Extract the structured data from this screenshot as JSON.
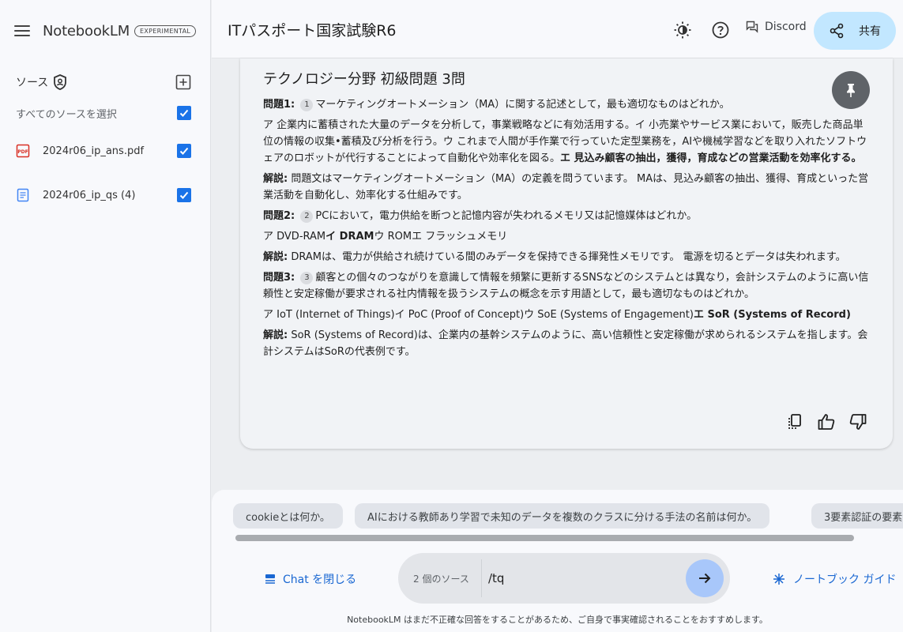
{
  "sidebar": {
    "brand_name": "NotebookLM",
    "brand_badge": "EXPERIMENTAL",
    "sources_title": "ソース",
    "select_all_label": "すべてのソースを選択",
    "sources": [
      {
        "name": "2024r06_ip_ans.pdf",
        "icon": "pdf-icon",
        "checked": true
      },
      {
        "name": "2024r06_ip_qs (4)",
        "icon": "document-icon",
        "checked": true
      }
    ]
  },
  "header": {
    "notebook_title": "ITパスポート国家試験R6",
    "discord_label": "Discord",
    "share_label": "共有"
  },
  "card": {
    "title": "テクノロジー分野 初級問題 3問",
    "q1": {
      "label": "問題1:",
      "ref": "1",
      "question": "マーケティングオートメーション（MA）に関する記述として，最も適切なものはどれか。",
      "options_text": "ア 企業内に蓄積された大量のデータを分析して，事業戦略などに有効活用する。イ 小売業やサービス業において，販売した商品単位の情報の収集•蓄積及び分析を行う。ウ これまで人間が手作業で行っていた定型業務を，AIや機械学習などを取り入れたソフトウェアのロボットが代行することによって自動化や効率化を図る。",
      "answer": "エ 見込み顧客の抽出，獲得，育成などの営業活動を効率化する。",
      "explain_label": "解説:",
      "explanation": "問題文はマーケティングオートメーション（MA）の定義を問うています。 MAは、見込み顧客の抽出、獲得、育成といった営業活動を自動化し、効率化する仕組みです。"
    },
    "q2": {
      "label": "問題2:",
      "ref": "2",
      "question": "PCにおいて，電力供給を断つと記憶内容が失われるメモリ又は記憶媒体はどれか。",
      "opt_a": "ア DVD-RAM",
      "answer": "イ DRAM",
      "opt_rest": "ウ ROMエ フラッシュメモリ",
      "explain_label": "解説:",
      "explanation": "DRAMは、電力が供給され続けている間のみデータを保持できる揮発性メモリです。 電源を切るとデータは失われます。"
    },
    "q3": {
      "label": "問題3:",
      "ref": "3",
      "question": "顧客との個々のつながりを意識して情報を頻繁に更新するSNSなどのシステムとは異なり，会計システムのように高い信頼性と安定稼働が要求される社内情報を扱うシステムの概念を示す用語として，最も適切なものはどれか。",
      "options_text": "ア IoT (Internet of Things)イ PoC (Proof of Concept)ウ SoE (Systems of Engagement)",
      "answer": "エ SoR (Systems of Record)",
      "explain_label": "解説:",
      "explanation": "SoR (Systems of Record)は、企業内の基幹システムのように、高い信頼性と安定稼働が求められるシステムを指します。会計システムはSoRの代表例です。"
    }
  },
  "suggestions": [
    "cookieとは何か。",
    "AIにおける教師あり学習で未知のデータを複数のクラスに分ける手法の名前は何か。",
    "3要素認証の要素"
  ],
  "composer": {
    "close_chat_label": "Chat を閉じる",
    "source_count": "2 個のソース",
    "query_value": "/tq",
    "guide_label": "ノートブック ガイド"
  },
  "footer": {
    "disclaimer": "NotebookLM はまだ不正確な回答をすることがあるため、ご自身で事実確認されることをおすすめします。"
  },
  "colors": {
    "accent": "#1a73e8",
    "share_bg": "#c2e7ff",
    "send_bg": "#a8c7fa",
    "link": "#1967d2"
  }
}
